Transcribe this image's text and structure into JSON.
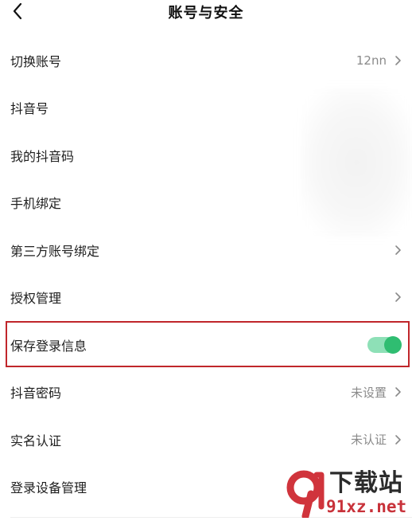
{
  "header": {
    "title": "账号与安全",
    "back_icon": "chevron-left-icon"
  },
  "settings": {
    "switch_account": {
      "label": "切换账号",
      "value": "12nn"
    },
    "douyin_id": {
      "label": "抖音号"
    },
    "my_qr_code": {
      "label": "我的抖音码"
    },
    "phone_binding": {
      "label": "手机绑定"
    },
    "third_party_binding": {
      "label": "第三方账号绑定"
    },
    "authorization": {
      "label": "授权管理"
    },
    "save_login_info": {
      "label": "保存登录信息",
      "enabled": true
    },
    "password": {
      "label": "抖音密码",
      "value": "未设置"
    },
    "real_name": {
      "label": "实名认证",
      "value": "未认证"
    },
    "device_management": {
      "label": "登录设备管理"
    }
  },
  "watermark": {
    "cn": "下载站",
    "url": "91xz.net"
  },
  "colors": {
    "toggle_track": "#8ee0b7",
    "toggle_knob": "#2fbd71",
    "highlight_border": "#c0262b",
    "secondary_text": "#8a8a8a",
    "watermark_red": "#c8323a"
  }
}
